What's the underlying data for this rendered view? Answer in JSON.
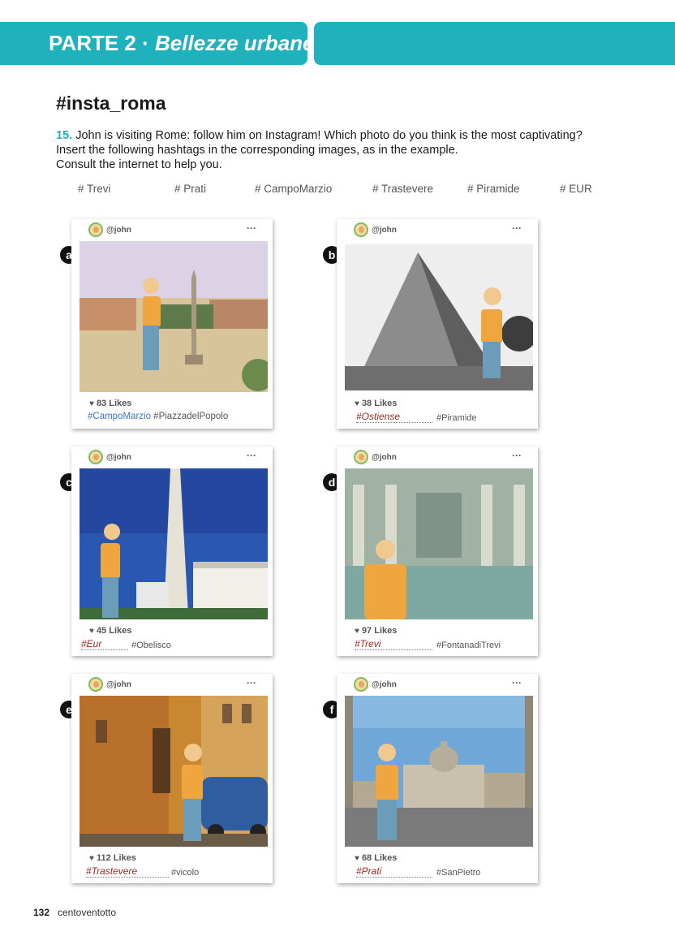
{
  "header": {
    "part": "PARTE 2 · ",
    "subtitle": "Bellezze urbane"
  },
  "section_title": "#insta_roma",
  "instruction": {
    "number": "15.",
    "line1": " John is visiting Rome: follow him on Instagram! Which photo do you think is the most captivating?",
    "line2": "Insert the following hashtags in the corresponding images, as in the example.",
    "line3": "Consult the internet to help you."
  },
  "hashtags": [
    "# Trevi",
    "# Prati",
    "# CampoMarzio",
    "# Trastevere",
    "# Piramide",
    "# EUR"
  ],
  "posts": [
    {
      "letter": "a",
      "user": "@john",
      "menu": "···",
      "likes": "83 Likes",
      "answer": "#CampoMarzio",
      "tag": " #PiazzadelPopolo"
    },
    {
      "letter": "b",
      "user": "@john",
      "menu": "···",
      "likes": "38 Likes",
      "answer": "#Ostiense",
      "tag": "#Piramide"
    },
    {
      "letter": "c",
      "user": "@john",
      "menu": "···",
      "likes": "45 Likes",
      "answer": "#Eur",
      "tag": "#Obelisco"
    },
    {
      "letter": "d",
      "user": "@john",
      "menu": "···",
      "likes": "97 Likes",
      "answer": "#Trevi",
      "tag": "#FontanadiTrevi"
    },
    {
      "letter": "e",
      "user": "@john",
      "menu": "···",
      "likes": "112 Likes",
      "answer": "#Trastevere",
      "tag": "#vicolo"
    },
    {
      "letter": "f",
      "user": "@john",
      "menu": "···",
      "likes": "68 Likes",
      "answer": "#Prati",
      "tag": "#SanPietro"
    }
  ],
  "footer": {
    "page_number": "132",
    "page_word": "centoventotto"
  },
  "colors": {
    "accent": "#1fb2bd",
    "handwriting": "#a12b1e",
    "hashtag_blue": "#3a76c4"
  }
}
